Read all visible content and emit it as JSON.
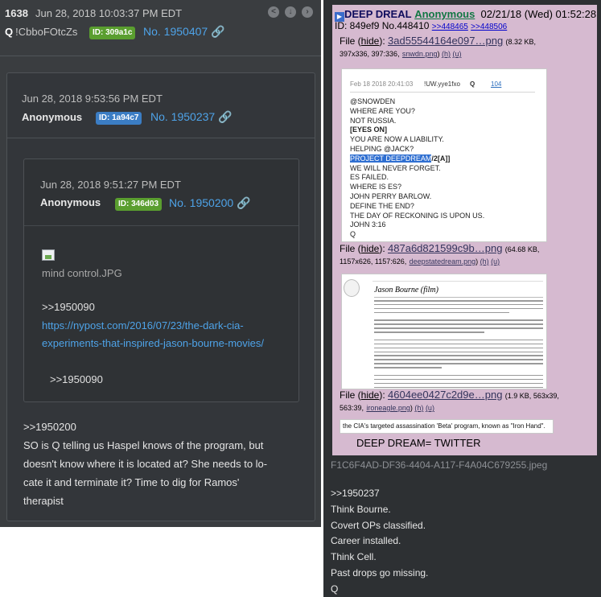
{
  "left": {
    "header": {
      "post_number": "1638",
      "datetime": "Jun 28, 2018 10:03:37 PM EDT",
      "trip_name": "Q",
      "tripcode": "!CbboFOtcZs",
      "id_label": "ID: 309a1c",
      "post_no": "No. 1950407"
    },
    "quote1": {
      "datetime": "Jun 28, 2018 9:53:56 PM EDT",
      "name": "Anonymous",
      "id_label": "ID: 1a94c7",
      "post_no": "No. 1950237",
      "nested": {
        "datetime": "Jun 28, 2018 9:51:27 PM EDT",
        "name": "Anonymous",
        "id_label": "ID: 346d03",
        "post_no": "No. 1950200",
        "image_name": "mind control.JPG",
        "ref1": ">>1950090",
        "url": "https://nypost.com/2016/07/23/the-dark-cia-experiments-that-inspired-jason-bourne-movies/",
        "ref2": ">>1950090"
      },
      "body_lines": [
        ">>1950200",
        "SO is Q telling us Haspel knows of the program, but",
        "doesn't know where it is located at? She needs to lo-",
        "cate it and terminate it? Time to dig for Ramos'",
        "therapist"
      ]
    }
  },
  "right": {
    "header": {
      "subject": "DEEP DREAL",
      "name": "Anonymous",
      "datetime": "02/21/18 (Wed) 01:52:28"
    },
    "id_line": {
      "id": "ID: 849ef9 No.448410",
      "backlink1": ">>448465",
      "backlink2": ">>448506"
    },
    "files": [
      {
        "label": "File (",
        "hide": "hide",
        "name": "3ad55544164e097…png",
        "size": "(8.32 KB,",
        "dims": "397x336, 397:336,",
        "orig": "snwdn.png",
        "h": "(h)",
        "u": "(u)"
      },
      {
        "label": "File (",
        "hide": "hide",
        "name": "487a6d821599c9b…png",
        "size": "(64.68 KB,",
        "dims": "1157x626, 1157:626,",
        "orig": "deepstatedream.png",
        "h": "(h)",
        "u": "(u)"
      },
      {
        "label": "File (",
        "hide": "hide",
        "name": "4604ee0427c2d9e…png",
        "size": "(1.9 KB, 563x39,",
        "dims": "563:39,",
        "orig": "ironeagle.png",
        "h": "(h)",
        "u": "(u)"
      }
    ],
    "snowden_drop": {
      "date": "Feb 18 2018 20:41:03",
      "trip": "!UW.yye1fxo",
      "q": "Q",
      "ref": "104",
      "lines": [
        "@SNOWDEN",
        "WHERE ARE YOU?",
        "NOT RUSSIA.",
        "[EYES ON]",
        "YOU ARE NOW A LIABILITY.",
        "HELPING @JACK?",
        "PROJECT DEEPDREAM",
        "WE WILL NEVER FORGET.",
        "ES FAILED.",
        "WHERE IS ES?",
        "JOHN PERRY BARLOW.",
        "DEFINE THE END?",
        "THE DAY OF RECKONING IS UPON US.",
        "JOHN 3:16",
        "Q"
      ],
      "highlight_suffix": "/2[A]]"
    },
    "bourne_page": {
      "title": "Jason Bourne (film)"
    },
    "ironhand_text": "the CIA's targeted assassination 'Beta' program, known as \"Iron Hand\".",
    "deep_dream_text": "DEEP DREAM= TWITTER",
    "filename": "F1C6F4AD-DF36-4404-A117-F4A04C679255.jpeg",
    "body_lines": [
      ">>1950237",
      "Think Bourne.",
      "Covert OPs classified.",
      "Career installed.",
      "Think Cell.",
      "Past drops go missing.",
      "Q"
    ]
  }
}
